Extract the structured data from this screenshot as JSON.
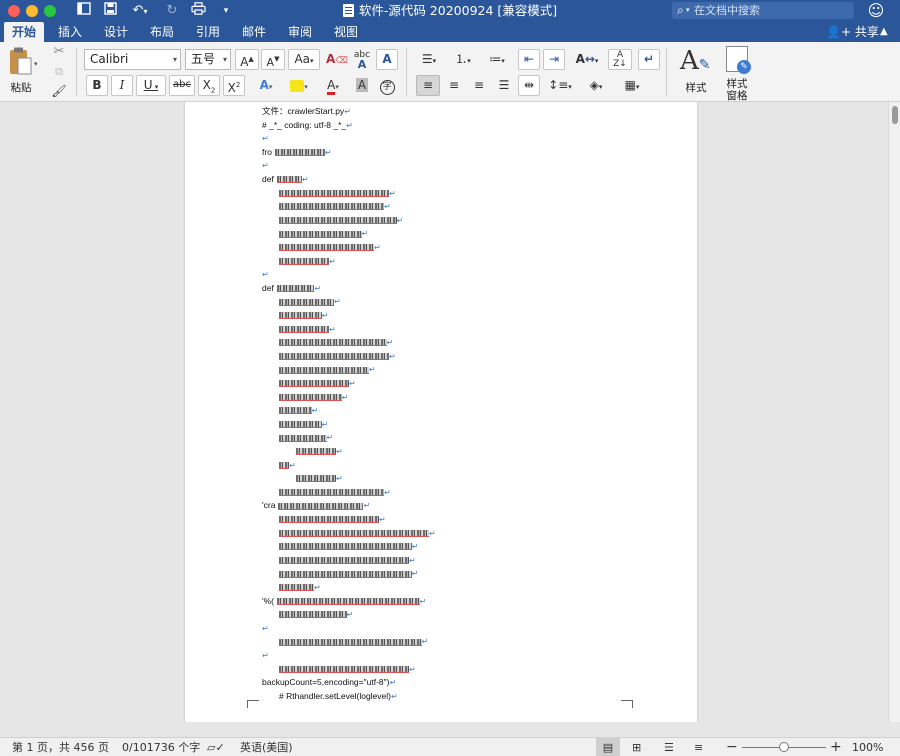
{
  "window": {
    "title": "软件-源代码 20200924 [兼容模式]",
    "search_placeholder": "在文档中搜索",
    "colors": {
      "titlebar": "#2b579a",
      "close": "#fe5f57",
      "minimize": "#febc2e",
      "maximize": "#28c840"
    }
  },
  "tabs": [
    "开始",
    "插入",
    "设计",
    "布局",
    "引用",
    "邮件",
    "审阅",
    "视图"
  ],
  "share_label": "共享",
  "ribbon": {
    "paste_label": "粘贴",
    "font_name": "Calibri",
    "font_size": "五号",
    "grow_font": "A",
    "shrink_font": "A",
    "change_case": "Aa",
    "bold": "B",
    "italic": "I",
    "underline": "U",
    "strike": "abc",
    "subscript": "X",
    "subscript_mark": "2",
    "superscript": "X",
    "superscript_mark": "2",
    "phonetic": "字",
    "styles_label": "样式",
    "styles_pane_label": "样式\n窗格"
  },
  "document": {
    "lines": [
      {
        "text": "文件：crawlerStart.py",
        "indent": 0,
        "blur": 0
      },
      {
        "text": "# _*_ coding: utf-8 _*_",
        "indent": 0,
        "blur": 0
      },
      {
        "text": "",
        "indent": 0,
        "blur": 0
      },
      {
        "text": "fro",
        "indent": 0,
        "blur": 100
      },
      {
        "text": "",
        "indent": 0,
        "blur": 0
      },
      {
        "text": "def",
        "indent": 0,
        "blur": 50
      },
      {
        "text": "",
        "indent": 1,
        "blur": 220
      },
      {
        "text": "",
        "indent": 1,
        "blur": 210
      },
      {
        "text": "",
        "indent": 1,
        "blur": 235
      },
      {
        "text": "",
        "indent": 1,
        "blur": 165
      },
      {
        "text": "",
        "indent": 1,
        "blur": 190
      },
      {
        "text": "",
        "indent": 1,
        "blur": 100
      },
      {
        "text": "",
        "indent": 0,
        "blur": 0
      },
      {
        "text": "def",
        "indent": 0,
        "blur": 75
      },
      {
        "text": "",
        "indent": 1,
        "blur": 110
      },
      {
        "text": "",
        "indent": 1,
        "blur": 85
      },
      {
        "text": "",
        "indent": 1,
        "blur": 100
      },
      {
        "text": "",
        "indent": 1,
        "blur": 215
      },
      {
        "text": "",
        "indent": 1,
        "blur": 220
      },
      {
        "text": "",
        "indent": 1,
        "blur": 180
      },
      {
        "text": "",
        "indent": 1,
        "blur": 140
      },
      {
        "text": "",
        "indent": 1,
        "blur": 125
      },
      {
        "text": "",
        "indent": 1,
        "blur": 65
      },
      {
        "text": "",
        "indent": 1,
        "blur": 85
      },
      {
        "text": "",
        "indent": 1,
        "blur": 95
      },
      {
        "text": "",
        "indent": 2,
        "blur": 80
      },
      {
        "text": "",
        "indent": 1,
        "blur": 20
      },
      {
        "text": "",
        "indent": 2,
        "blur": 80
      },
      {
        "text": "",
        "indent": 1,
        "blur": 210
      },
      {
        "text": "'cra",
        "indent": 0,
        "blur": 170
      },
      {
        "text": "",
        "indent": 1,
        "blur": 200
      },
      {
        "text": "",
        "indent": 1,
        "blur": 300
      },
      {
        "text": "",
        "indent": 1,
        "blur": 265
      },
      {
        "text": "",
        "indent": 1,
        "blur": 260
      },
      {
        "text": "",
        "indent": 1,
        "blur": 265
      },
      {
        "text": "",
        "indent": 1,
        "blur": 70
      },
      {
        "text": "'%(",
        "indent": 0,
        "blur": 285
      },
      {
        "text": "",
        "indent": 1,
        "blur": 135
      },
      {
        "text": "",
        "indent": 0,
        "blur": 0
      },
      {
        "text": "",
        "indent": 1,
        "blur": 285
      },
      {
        "text": "",
        "indent": 0,
        "blur": 0
      },
      {
        "text": "",
        "indent": 1,
        "blur": 260
      },
      {
        "text": "backupCount=5,encoding=\"utf-8\")",
        "indent": 0,
        "blur": 0
      },
      {
        "text": "# Rthandler.setLevel(loglevel)",
        "indent": 1,
        "blur": 0
      }
    ]
  },
  "status": {
    "page_info": "第 1 页，共 456 页",
    "word_count": "0/101736 个字",
    "language": "英语(美国)",
    "zoom": "100%",
    "zoom_fraction": 0.5
  }
}
